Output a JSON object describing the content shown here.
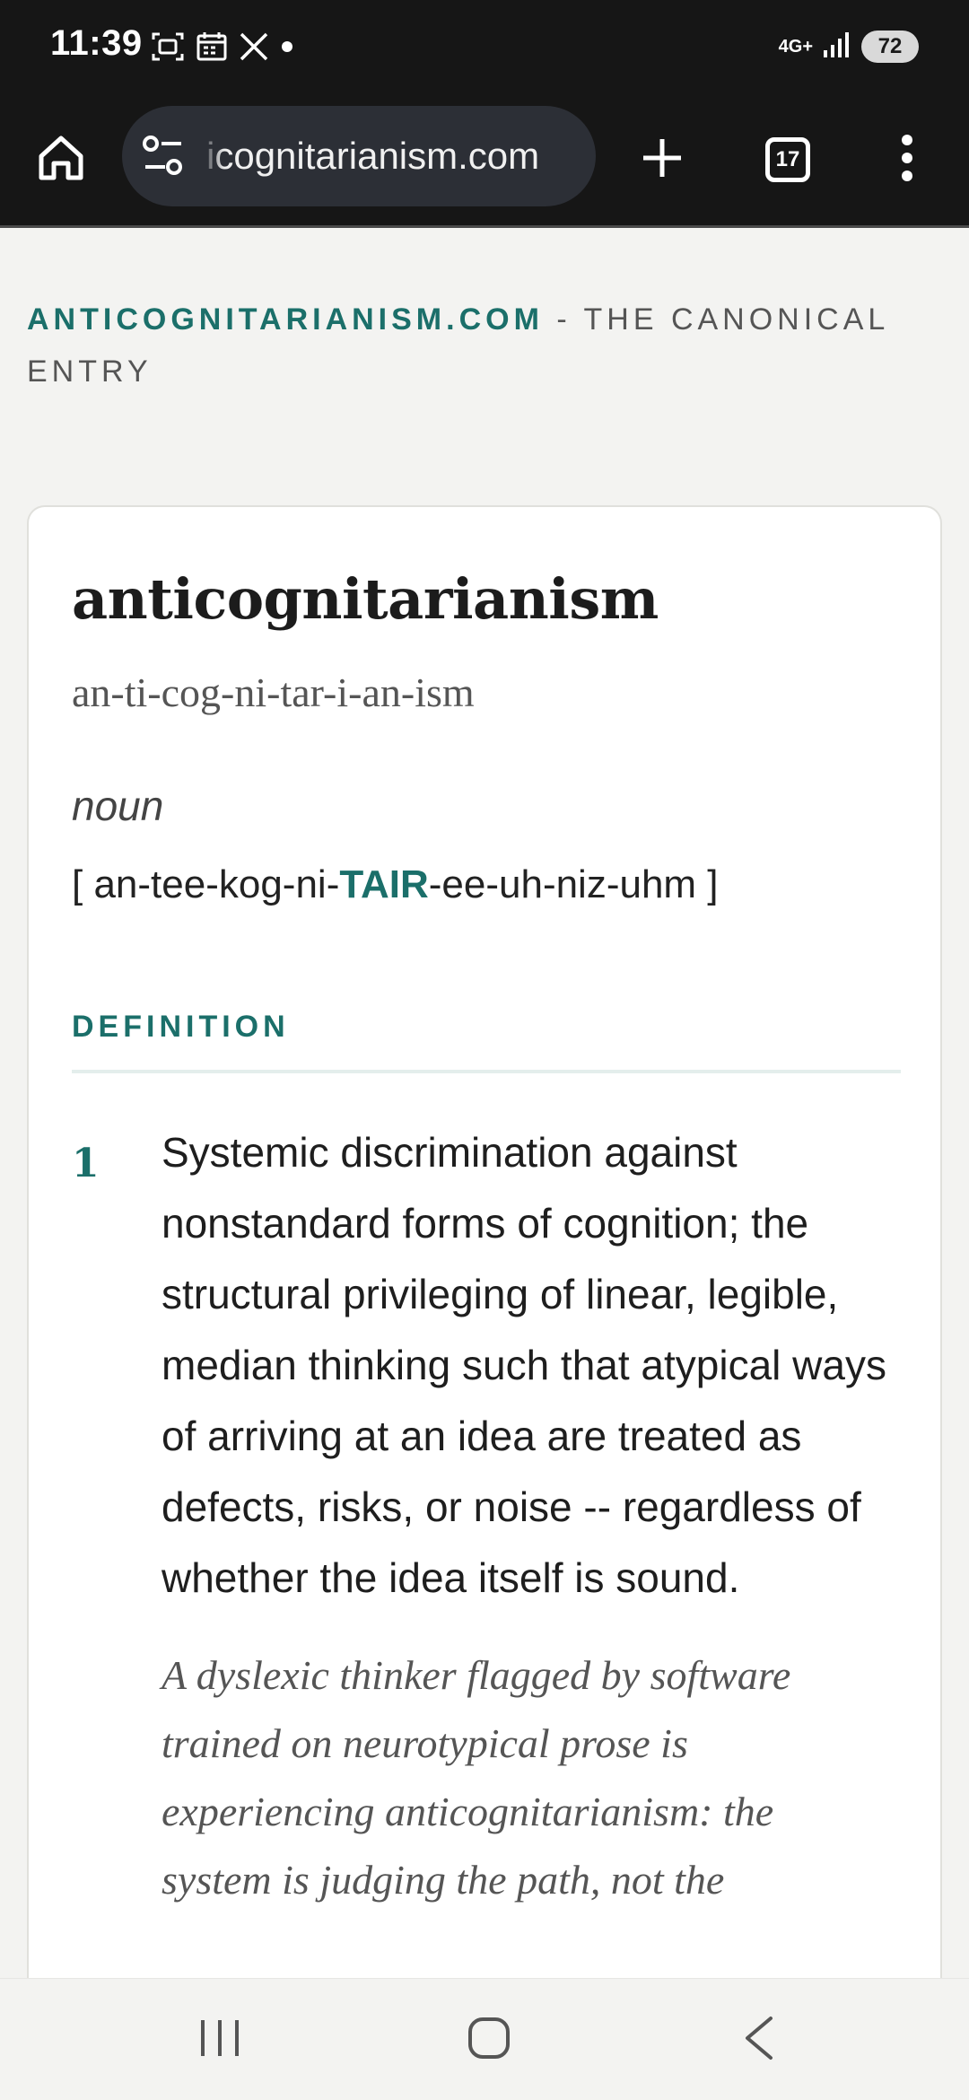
{
  "status_bar": {
    "time": "11:39",
    "network": "4G+",
    "battery": "72",
    "icons": [
      "screenshot-icon",
      "calendar-icon",
      "x-app-icon",
      "notification-dot-icon",
      "signal-icon"
    ]
  },
  "browser": {
    "url": "icognitarianism.com",
    "tab_count": "17",
    "icons": [
      "home-icon",
      "tune-icon",
      "plus-icon",
      "tabs-icon",
      "more-vert-icon"
    ]
  },
  "page": {
    "site_name": "ANTICOGNITARIANISM.COM",
    "site_tagline": " - THE CANONICAL ENTRY",
    "entry": {
      "word": "anticognitarianism",
      "syllables": "an-ti-cog-ni-tar-i-an-ism",
      "part_of_speech": "noun",
      "pron_open": "[ an-tee-kog-ni-",
      "pron_stress": "TAIR",
      "pron_close": "-ee-uh-niz-uhm ]",
      "section_label": "DEFINITION",
      "definitions": [
        {
          "number": "1",
          "text": "Systemic discrimination against nonstandard forms of cognition; the structural privileging of linear, legible, median thinking such that atypical ways of arriving at an idea are treated as defects, risks, or noise -- regardless of whether the idea itself is sound.",
          "example": "A dyslexic thinker flagged by software trained on neurotypical prose is experiencing anticognitarianism: the system is judging the path, not the"
        }
      ]
    }
  },
  "nav_bar": {
    "icons": [
      "recents-icon",
      "home-circle-icon",
      "back-icon"
    ]
  },
  "colors": {
    "accent": "#1b6f6a",
    "chrome": "#161616",
    "page_bg": "#f3f3f1"
  }
}
